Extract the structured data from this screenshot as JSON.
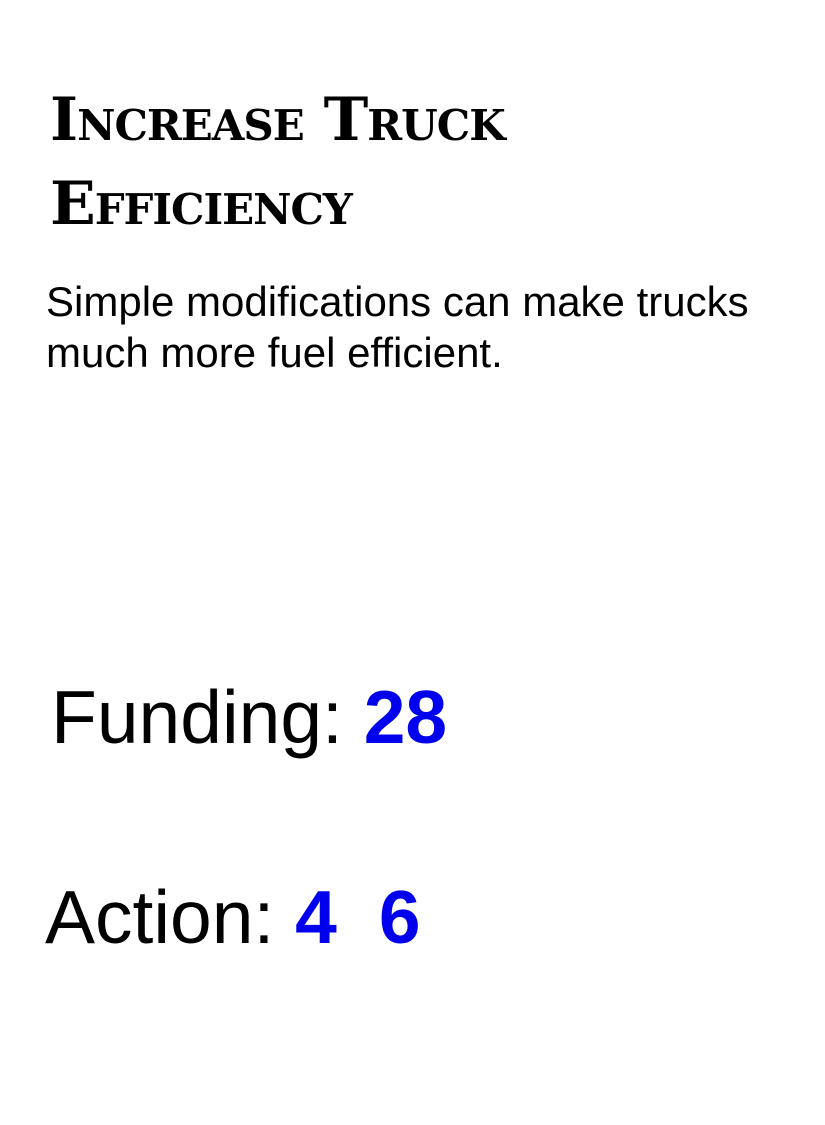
{
  "card": {
    "title": "Increase Truck Efficiency",
    "description": "Simple modifications can make trucks much more fuel efficient.",
    "funding": {
      "label": "Funding: ",
      "value": "28"
    },
    "action": {
      "label": "Action: ",
      "values": [
        "4",
        "6"
      ]
    }
  },
  "colors": {
    "text": "#000000",
    "value_accent": "#0000ee",
    "background": "#ffffff"
  }
}
